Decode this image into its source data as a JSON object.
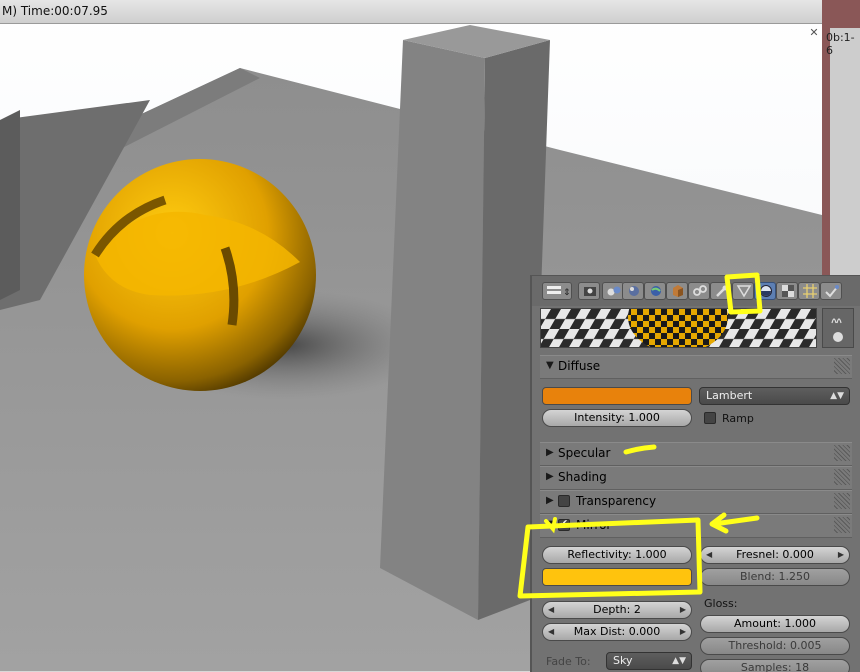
{
  "render_window": {
    "time_text": "M) Time:00:07.95",
    "right_label": "0b:1-6",
    "close_icon": "close-x-icon"
  },
  "properties": {
    "context_tabs": [
      {
        "icon": "render-context-icon"
      },
      {
        "icon": "render-layers-icon"
      },
      {
        "icon": "scene-icon"
      },
      {
        "icon": "world-icon"
      },
      {
        "icon": "object-icon"
      },
      {
        "icon": "constraints-icon"
      },
      {
        "icon": "modifiers-icon"
      },
      {
        "icon": "data-icon"
      },
      {
        "icon": "material-icon",
        "active": true
      },
      {
        "icon": "texture-icon"
      },
      {
        "icon": "particles-icon"
      },
      {
        "icon": "physics-icon"
      }
    ],
    "diffuse": {
      "title": "Diffuse",
      "color": "#e8820c",
      "shader": "Lambert",
      "intensity": "Intensity: 1.000",
      "ramp_label": "Ramp"
    },
    "specular": {
      "title": "Specular"
    },
    "shading": {
      "title": "Shading"
    },
    "transparency": {
      "title": "Transparency"
    },
    "mirror": {
      "title": "Mirror",
      "enabled": true,
      "reflectivity": "Reflectivity: 1.000",
      "color": "#ffc30d",
      "fresnel": "Fresnel: 0.000",
      "blend": "Blend: 1.250",
      "depth": "Depth: 2",
      "max_dist": "Max Dist: 0.000",
      "gloss_label": "Gloss:",
      "amount": "Amount: 1.000",
      "threshold": "Threshold: 0.005",
      "samples": "Samples: 18",
      "fade_to_label": "Fade To:",
      "fade_to_value": "Sky"
    }
  },
  "colors": {
    "annotation": "#ffff1a",
    "sphere": "#e8a800"
  }
}
